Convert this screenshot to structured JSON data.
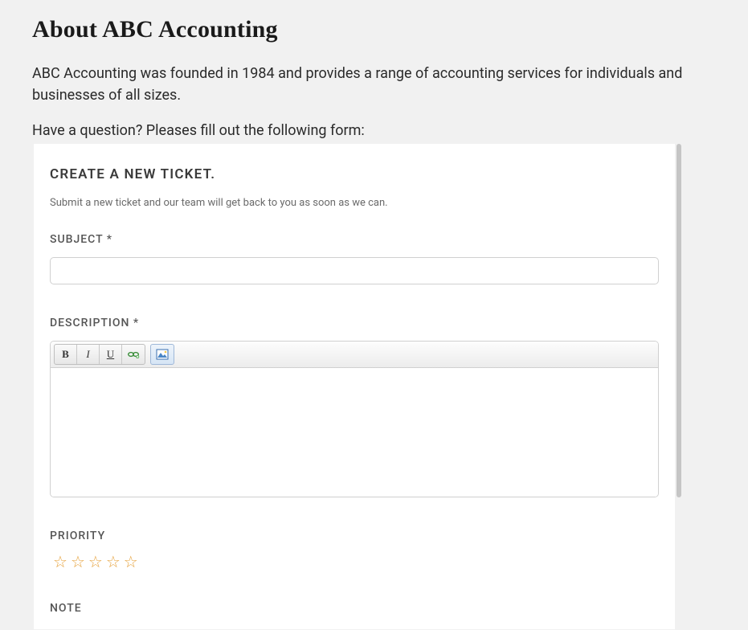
{
  "page": {
    "title": "About ABC Accounting",
    "intro": "ABC Accounting was founded in 1984 and provides a range of accounting services for individuals and businesses of all sizes.",
    "prompt": "Have a question? Pleases fill out the following form:"
  },
  "form": {
    "heading": "CREATE A NEW TICKET.",
    "subtext": "Submit a new ticket and our team will get back to you as soon as we can.",
    "fields": {
      "subject": {
        "label": "SUBJECT *",
        "value": ""
      },
      "description": {
        "label": "DESCRIPTION *",
        "value": ""
      },
      "priority": {
        "label": "PRIORITY",
        "stars_total": 5,
        "stars_selected": 0,
        "star_glyph": "☆"
      },
      "note": {
        "label": "NOTE"
      }
    },
    "editor_toolbar": {
      "bold": "B",
      "italic": "I",
      "underline": "U"
    }
  }
}
